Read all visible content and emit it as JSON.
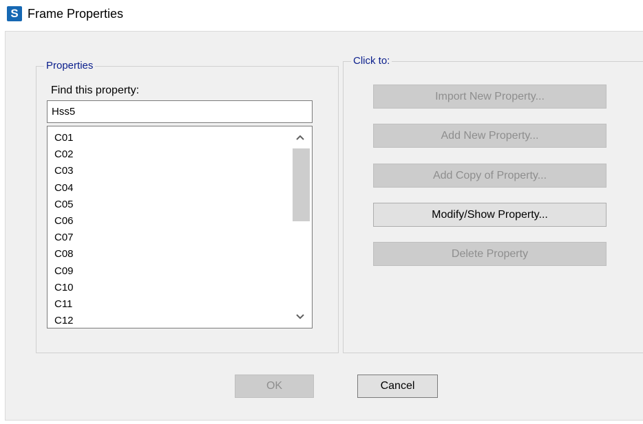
{
  "window": {
    "icon_letter": "S",
    "title": "Frame Properties"
  },
  "properties_group": {
    "label": "Properties",
    "find_label": "Find this property:",
    "find_value": "Hss5",
    "items": [
      "C01",
      "C02",
      "C03",
      "C04",
      "C05",
      "C06",
      "C07",
      "C08",
      "C09",
      "C10",
      "C11",
      "C12"
    ]
  },
  "click_group": {
    "label": "Click to:",
    "import_label": "Import New Property...",
    "add_label": "Add New Property...",
    "copy_label": "Add Copy of Property...",
    "modify_label": "Modify/Show Property...",
    "delete_label": "Delete Property"
  },
  "footer": {
    "ok_label": "OK",
    "cancel_label": "Cancel"
  },
  "icons": {
    "scroll_up": "chevron-up-icon",
    "scroll_down": "chevron-down-icon"
  },
  "colors": {
    "app_icon": "#1668b3",
    "group_label": "#0a1e8c",
    "dialog_bg": "#f0f0f0"
  }
}
